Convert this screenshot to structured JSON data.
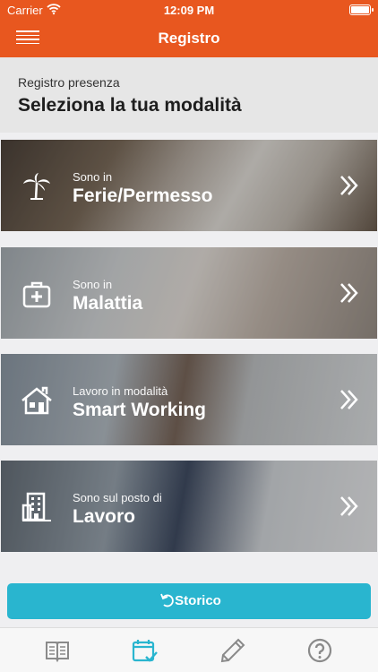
{
  "status_bar": {
    "carrier": "Carrier",
    "time": "12:09 PM"
  },
  "nav": {
    "title": "Registro"
  },
  "header": {
    "subtitle": "Registro presenza",
    "title": "Seleziona la tua modalità"
  },
  "cards": [
    {
      "small": "Sono in",
      "big": "Ferie/Permesso",
      "icon": "palm-tree-icon"
    },
    {
      "small": "Sono in",
      "big": "Malattia",
      "icon": "first-aid-kit-icon"
    },
    {
      "small": "Lavoro in modalità",
      "big": "Smart Working",
      "icon": "house-icon"
    },
    {
      "small": "Sono sul posto di",
      "big": "Lavoro",
      "icon": "office-building-icon"
    }
  ],
  "storico": {
    "label": "Storico",
    "icon": "undo-icon"
  },
  "tabs": [
    {
      "icon": "book-icon",
      "active": false
    },
    {
      "icon": "calendar-check-icon",
      "active": true
    },
    {
      "icon": "pencil-icon",
      "active": false
    },
    {
      "icon": "help-icon",
      "active": false
    }
  ],
  "colors": {
    "primary": "#e8571f",
    "accent": "#29b5cf",
    "tab_inactive": "#8a8a8a"
  }
}
